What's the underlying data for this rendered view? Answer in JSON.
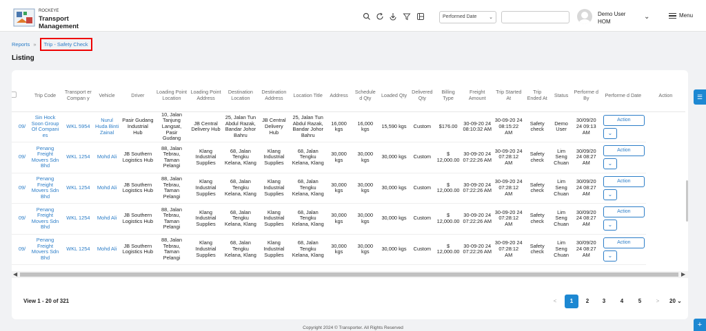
{
  "header": {
    "brand_small": "ROCKEYE",
    "brand_title_1": "Transport",
    "brand_title_2": "Management",
    "date_filter": "Performed Date",
    "user_name": "Demo User",
    "user_org": "HOM",
    "menu_label": "Menu",
    "accent": "#1d88d2"
  },
  "breadcrumb": {
    "parent": "Reports",
    "current": "Trip - Safety Check"
  },
  "page_title": "Listing",
  "table": {
    "columns": [
      "Trip Code",
      "Transport er Compan y",
      "Vehicle",
      "Driver",
      "Loading Point Location",
      "Loading Point Address",
      "Destination Location",
      "Destination Address",
      "Location Title",
      "Address",
      "Schedule d Qty",
      "Loaded Qty",
      "Delivered Qty",
      "Billing Type",
      "Freight Amount",
      "Trip Started At",
      "Trip Ended At",
      "Status",
      "Performe d By",
      "Performe d Date",
      "Action"
    ],
    "action_label": "Action",
    "rows": [
      {
        "trip_code": "09/",
        "transporter": "Sin Hock Soon Group Of Compani es",
        "vehicle": "WKL 5954",
        "driver": "Nurul Huda Binti Zainal",
        "loading_location": "Pasir Gudang Industrial Hub",
        "loading_address": "10, Jalan Tanjung Langsat, Pasir Gudang",
        "destination_location": "JB Central Delivery Hub",
        "destination_address": "25, Jalan Tun Abdul Razak, Bandar Johor Bahru",
        "location_title": "JB Central Delivery Hub",
        "address": "25, Jalan Tun Abdul Razak, Bandar Johor Bahru",
        "scheduled_qty": "16,000 kgs",
        "loaded_qty": "16,000 kgs",
        "delivered_qty": "15,590 kgs",
        "billing_type": "Custom",
        "freight_amount": "$176.00",
        "trip_started": "30-09-20 24 08:10:32 AM",
        "trip_ended": "30-09-20 24 08:15:22 AM",
        "status": "Safety check",
        "performed_by": "Demo User",
        "performed_date": "30/09/20 24 09:13 AM"
      },
      {
        "trip_code": "09/",
        "transporter": "Penang Freight Movers Sdn Bhd",
        "vehicle": "WKL 1254",
        "driver": "Mohd Ali",
        "loading_location": "JB Southern Logistics Hub",
        "loading_address": "88, Jalan Tebrau, Taman Pelangi",
        "destination_location": "Klang Industrial Supplies",
        "destination_address": "68, Jalan Tengku Kelana, Klang",
        "location_title": "Klang Industrial Supplies",
        "address": "68, Jalan Tengku Kelana, Klang",
        "scheduled_qty": "30,000 kgs",
        "loaded_qty": "30,000 kgs",
        "delivered_qty": "30,000 kgs",
        "billing_type": "Custom",
        "freight_amount": "$ 12,000.00",
        "trip_started": "30-09-20 24 07:22:26 AM",
        "trip_ended": "30-09-20 24 07:28:12 AM",
        "status": "Safety check",
        "performed_by": "Lim Seng Chuan",
        "performed_date": "30/09/20 24 08:27 AM"
      },
      {
        "trip_code": "09/",
        "transporter": "Penang Freight Movers Sdn Bhd",
        "vehicle": "WKL 1254",
        "driver": "Mohd Ali",
        "loading_location": "JB Southern Logistics Hub",
        "loading_address": "88, Jalan Tebrau, Taman Pelangi",
        "destination_location": "Klang Industrial Supplies",
        "destination_address": "68, Jalan Tengku Kelana, Klang",
        "location_title": "Klang Industrial Supplies",
        "address": "68, Jalan Tengku Kelana, Klang",
        "scheduled_qty": "30,000 kgs",
        "loaded_qty": "30,000 kgs",
        "delivered_qty": "30,000 kgs",
        "billing_type": "Custom",
        "freight_amount": "$ 12,000.00",
        "trip_started": "30-09-20 24 07:22:26 AM",
        "trip_ended": "30-09-20 24 07:28:12 AM",
        "status": "Safety check",
        "performed_by": "Lim Seng Chuan",
        "performed_date": "30/09/20 24 08:27 AM"
      },
      {
        "trip_code": "09/",
        "transporter": "Penang Freight Movers Sdn Bhd",
        "vehicle": "WKL 1254",
        "driver": "Mohd Ali",
        "loading_location": "JB Southern Logistics Hub",
        "loading_address": "88, Jalan Tebrau, Taman Pelangi",
        "destination_location": "Klang Industrial Supplies",
        "destination_address": "68, Jalan Tengku Kelana, Klang",
        "location_title": "Klang Industrial Supplies",
        "address": "68, Jalan Tengku Kelana, Klang",
        "scheduled_qty": "30,000 kgs",
        "loaded_qty": "30,000 kgs",
        "delivered_qty": "30,000 kgs",
        "billing_type": "Custom",
        "freight_amount": "$ 12,000.00",
        "trip_started": "30-09-20 24 07:22:26 AM",
        "trip_ended": "30-09-20 24 07:28:12 AM",
        "status": "Safety check",
        "performed_by": "Lim Seng Chuan",
        "performed_date": "30/09/20 24 08:27 AM"
      },
      {
        "trip_code": "09/",
        "transporter": "Penang Freight Movers Sdn Bhd",
        "vehicle": "WKL 1254",
        "driver": "Mohd Ali",
        "loading_location": "JB Southern Logistics Hub",
        "loading_address": "88, Jalan Tebrau, Taman Pelangi",
        "destination_location": "Klang Industrial Supplies",
        "destination_address": "68, Jalan Tengku Kelana, Klang",
        "location_title": "Klang Industrial Supplies",
        "address": "68, Jalan Tengku Kelana, Klang",
        "scheduled_qty": "30,000 kgs",
        "loaded_qty": "30,000 kgs",
        "delivered_qty": "30,000 kgs",
        "billing_type": "Custom",
        "freight_amount": "$ 12,000.00",
        "trip_started": "30-09-20 24 07:22:26 AM",
        "trip_ended": "30-09-20 24 07:28:12 AM",
        "status": "Safety check",
        "performed_by": "Lim Seng Chuan",
        "performed_date": "30/09/20 24 08:27 AM"
      }
    ]
  },
  "pagination": {
    "view_text": "View 1 - 20 of 321",
    "prev": "<",
    "next": ">",
    "pages": [
      "1",
      "2",
      "3",
      "4",
      "5"
    ],
    "current_page": "1",
    "per_page": "20"
  },
  "footer": "Copyright 2024 © Transporter. All Rights Reserved"
}
